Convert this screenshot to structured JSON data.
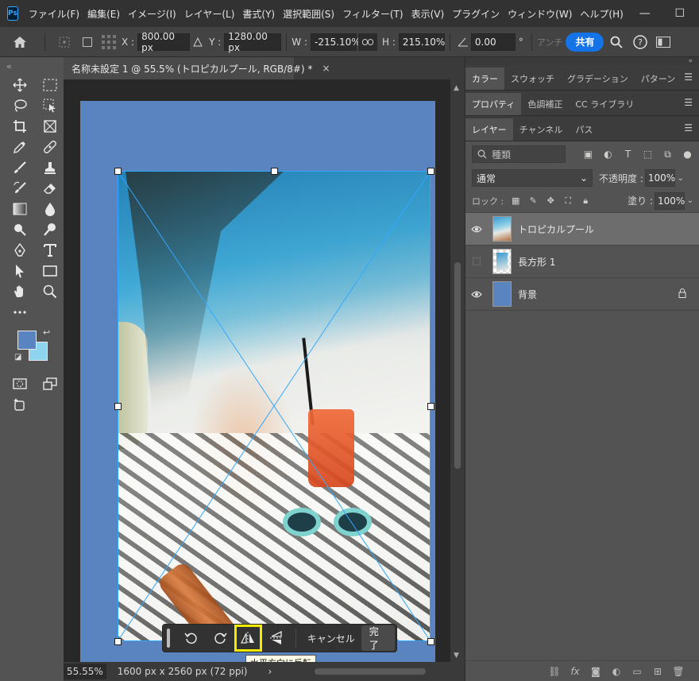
{
  "menubar": {
    "logo": "Ps",
    "items": [
      "ファイル(F)",
      "編集(E)",
      "イメージ(I)",
      "レイヤー(L)",
      "書式(Y)",
      "選択範囲(S)",
      "フィルター(T)",
      "表示(V)",
      "プラグイン",
      "ウィンドウ(W)",
      "ヘルプ(H)"
    ],
    "minimize": "—",
    "maximize": "☐",
    "close": "✕"
  },
  "options": {
    "x_label": "X :",
    "x_value": "800.00 px",
    "y_label": "Y :",
    "y_value": "1280.00 px",
    "w_label": "W :",
    "w_value": "-215.10%",
    "h_label": "H :",
    "h_value": "215.10%",
    "angle_value": "0.00",
    "angle_unit": "°",
    "antialias_label": "アンチ",
    "share_label": "共有"
  },
  "document": {
    "tab_title": "名称未設定 1 @ 55.5% (トロピカルプール, RGB/8#) *",
    "close": "×"
  },
  "colors": {
    "foreground": "#5a84bf",
    "background": "#8fd4ef",
    "accent": "#31a8ff",
    "highlight": "#f4e900"
  },
  "taskbar": {
    "rotate_left_icon": "rotate-ccw-icon",
    "rotate_right_icon": "rotate-cw-icon",
    "flip_h_icon": "flip-horizontal-icon",
    "flip_v_icon": "flip-vertical-icon",
    "cancel_label": "キャンセル",
    "done_label": "完了",
    "tooltip": "水平方向に反転"
  },
  "status": {
    "zoom": "55.55%",
    "doc_info": "1600 px x 2560 px (72 ppi)",
    "arrow": "›"
  },
  "panels": {
    "group1_tabs": [
      "カラー",
      "スウォッチ",
      "グラデーション",
      "パターン"
    ],
    "group2_tabs": [
      "プロパティ",
      "色調補正",
      "CC ライブラリ"
    ],
    "group3_tabs": [
      "レイヤー",
      "チャンネル",
      "パス"
    ],
    "filter_placeholder": "種類",
    "blend_mode": "通常",
    "opacity_label": "不透明度 :",
    "opacity_value": "100%",
    "lock_label": "ロック :",
    "fill_label": "塗り :",
    "fill_value": "100%",
    "layers": [
      {
        "name": "トロピカルプール",
        "visible": true,
        "selected": true
      },
      {
        "name": "長方形 1",
        "visible": false,
        "selected": false
      },
      {
        "name": "背景",
        "visible": true,
        "selected": false,
        "locked": true
      }
    ]
  }
}
